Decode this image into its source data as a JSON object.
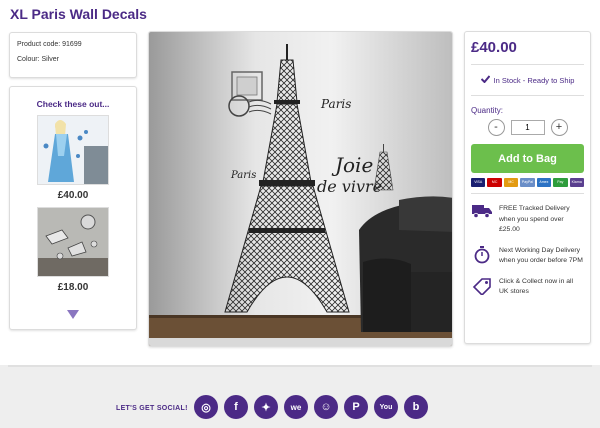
{
  "page": {
    "title": "XL Paris Wall Decals"
  },
  "product_info": {
    "code": "Product code: 91699",
    "colour": "Colour: Silver"
  },
  "recommendations": {
    "heading": "Check these out...",
    "items": [
      {
        "price": "£40.00",
        "image": "frozen-elsa-decal"
      },
      {
        "price": "£18.00",
        "image": "star-wars-decal"
      }
    ],
    "more_icon": "triangle-down-icon"
  },
  "hero_image": {
    "texts": {
      "paris_top": "Paris",
      "paris_side": "Paris",
      "joie_1": "Joie",
      "joie_2": "de vivre"
    }
  },
  "buy_box": {
    "price": "£40.00",
    "stock": "In Stock - Ready to Ship",
    "quantity_label": "Quantity:",
    "minus": "-",
    "plus": "+",
    "quantity_value": "1",
    "add_button": "Add to Bag",
    "payments": [
      {
        "name": "VISA",
        "color": "#1a1f71"
      },
      {
        "name": "MC",
        "color": "#cc0000"
      },
      {
        "name": "MC",
        "color": "#e39b12"
      },
      {
        "name": "PayPal",
        "color": "#6a8ec8"
      },
      {
        "name": "Amex",
        "color": "#2b72c4"
      },
      {
        "name": "Pay",
        "color": "#2e9d3c"
      },
      {
        "name": "Klarna",
        "color": "#5a3f8f"
      }
    ],
    "features": [
      {
        "icon": "truck-icon",
        "text": "FREE Tracked Delivery when you spend over £25.00"
      },
      {
        "icon": "stopwatch-icon",
        "text": "Next Working Day Delivery when you order before 7PM"
      },
      {
        "icon": "tag-icon",
        "text": "Click & Collect now in all UK stores"
      }
    ]
  },
  "footer": {
    "social_label": "LET'S GET SOCIAL!",
    "social": [
      {
        "icon": "instagram-icon",
        "glyph": "◎"
      },
      {
        "icon": "facebook-icon",
        "glyph": "f"
      },
      {
        "icon": "twitter-icon",
        "glyph": "✦"
      },
      {
        "icon": "weheartit-icon",
        "glyph": "we"
      },
      {
        "icon": "snapchat-icon",
        "glyph": "☺"
      },
      {
        "icon": "pinterest-icon",
        "glyph": "P"
      },
      {
        "icon": "youtube-icon",
        "glyph": "You"
      },
      {
        "icon": "blog-icon",
        "glyph": "b"
      }
    ]
  },
  "colors": {
    "brand": "#4b2a86",
    "add_button": "#6cbf4c"
  }
}
